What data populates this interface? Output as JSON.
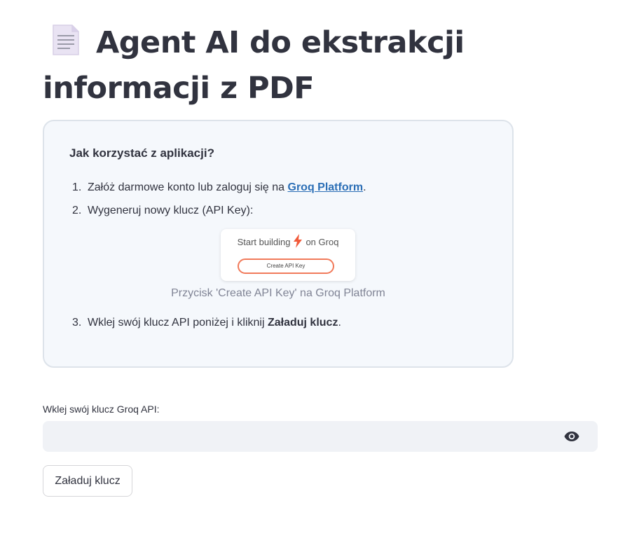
{
  "header": {
    "title": "Agent AI do ekstrakcji informacji z PDF",
    "icon": "page-facing-up-icon"
  },
  "instructions": {
    "heading": "Jak korzystać z aplikacji?",
    "steps": [
      {
        "number": "1.",
        "text_before": "Załóż darmowe konto lub zaloguj się na ",
        "link_text": "Groq Platform",
        "text_after": "."
      },
      {
        "number": "2.",
        "text": "Wygeneruj nowy klucz (API Key):"
      },
      {
        "number": "3.",
        "text_before": "Wklej swój klucz API poniżej i kliknij ",
        "bold_text": "Załaduj klucz",
        "text_after": "."
      }
    ],
    "image": {
      "line_left": "Start building",
      "line_right": "on Groq",
      "icon": "lightning-bolt-icon",
      "button_label": "Create API Key",
      "caption": "Przycisk 'Create API Key' na Groq Platform"
    }
  },
  "api_key_field": {
    "label": "Wklej swój klucz Groq API:",
    "value": "",
    "placeholder": "",
    "toggle_icon": "eye-icon"
  },
  "load_button": {
    "label": "Załaduj klucz"
  },
  "colors": {
    "text": "#31333f",
    "link": "#2c6fb6",
    "card_background": "#f5f8fc",
    "card_border": "#dde3ea",
    "input_background": "#f0f2f6",
    "caption": "#808495",
    "bolt": "#f15a3a"
  }
}
